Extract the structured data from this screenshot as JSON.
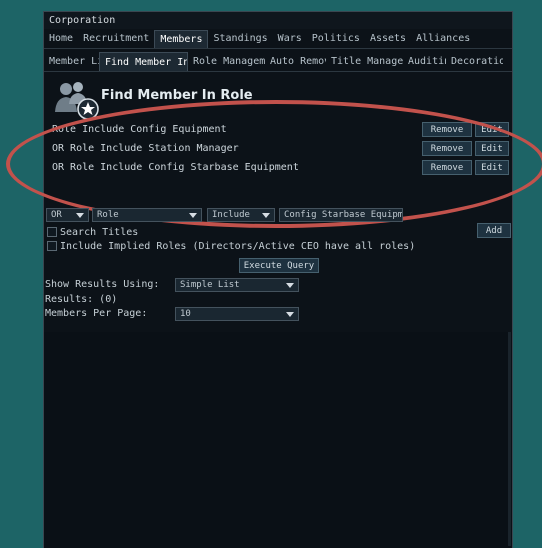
{
  "window": {
    "title": "Corporation"
  },
  "tabs_main": [
    "Home",
    "Recruitment",
    "Members",
    "Standings",
    "Wars",
    "Politics",
    "Assets",
    "Alliances"
  ],
  "tabs_sub": [
    "Member Li",
    "Find Member In R",
    "Role Manageme",
    "Auto Remov",
    "Title Manageme",
    "Auditin",
    "Decoratior"
  ],
  "header": {
    "title": "Find Member In Role"
  },
  "criteria": [
    {
      "text": "Role Include Config Equipment",
      "remove": "Remove",
      "edit": "Edit"
    },
    {
      "text": "OR Role Include Station Manager",
      "remove": "Remove",
      "edit": "Edit"
    },
    {
      "text": "OR Role Include Config Starbase Equipment",
      "remove": "Remove",
      "edit": "Edit"
    }
  ],
  "query": {
    "logic": "OR",
    "field": "Role",
    "op": "Include",
    "value": "Config Starbase Equipme",
    "add": "Add",
    "search_titles": "Search Titles",
    "include_implied": "Include Implied Roles (Directors/Active CEO have all roles)",
    "execute": "Execute Query"
  },
  "results": {
    "show_label": "Show Results Using:",
    "show_value": "Simple List",
    "count": "Results: (0)",
    "per_page_label": "Members Per Page:",
    "per_page_value": "10"
  },
  "colors": {
    "background": "#1d6466",
    "window": "#0c1218",
    "highlight": "#c2524c"
  }
}
